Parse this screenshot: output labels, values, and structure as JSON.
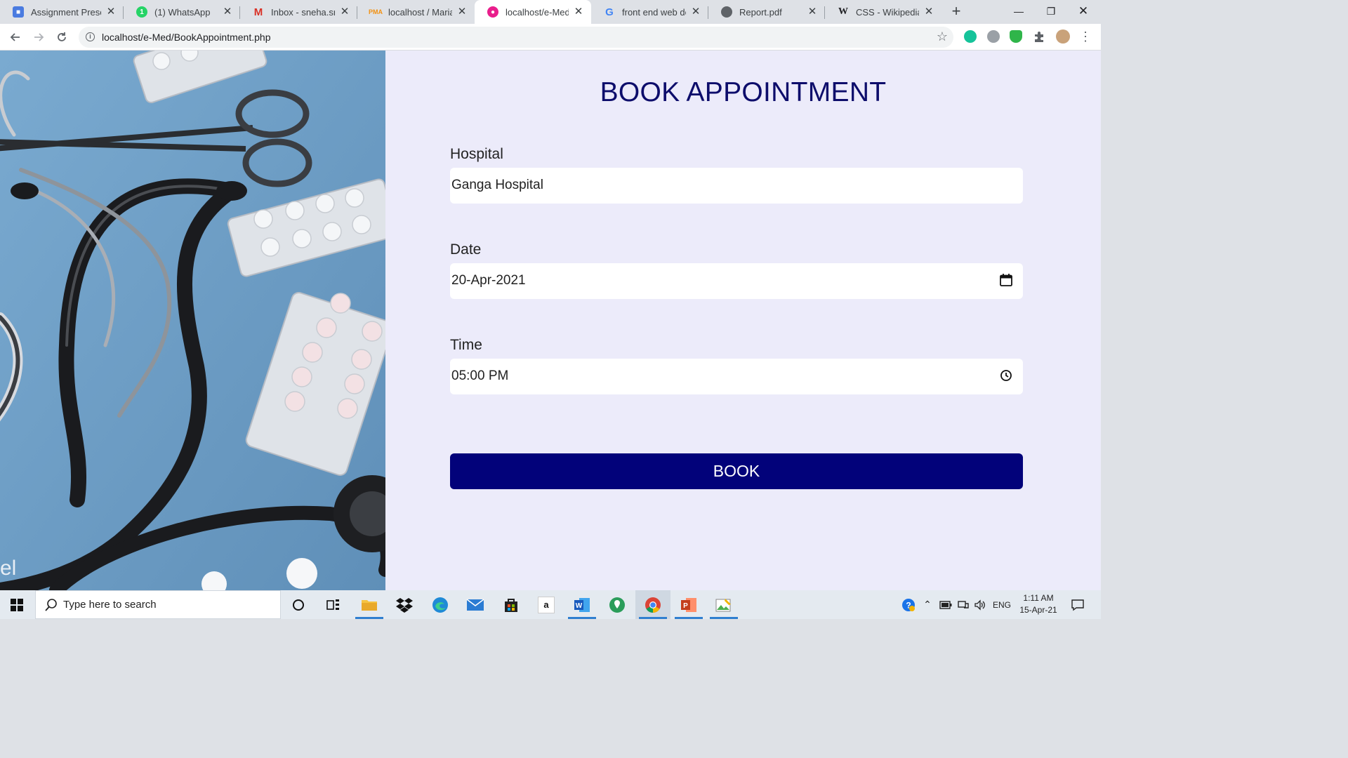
{
  "browser": {
    "tabs": [
      {
        "label": "Assignment Presen",
        "icon": "classroom-icon",
        "color": "#4a7be0",
        "active": false
      },
      {
        "label": "(1) WhatsApp",
        "icon": "whatsapp-icon",
        "color": "#25d366",
        "active": false
      },
      {
        "label": "Inbox - sneha.sridh",
        "icon": "gmail-icon",
        "color": "#d93025",
        "active": false
      },
      {
        "label": "localhost / MariaD",
        "icon": "phpmyadmin-icon",
        "color": "#f29111",
        "active": false
      },
      {
        "label": "localhost/e-Med/B",
        "icon": "site-icon",
        "color": "#e91e8c",
        "active": true
      },
      {
        "label": "front end web dev",
        "icon": "google-icon",
        "color": "#4285f4",
        "active": false
      },
      {
        "label": "Report.pdf",
        "icon": "globe-icon",
        "color": "#5f6368",
        "active": false
      },
      {
        "label": "CSS - Wikipedia",
        "icon": "wikipedia-icon",
        "color": "#202124",
        "active": false
      }
    ],
    "url": "localhost/e-Med/BookAppointment.php"
  },
  "page": {
    "title": "BOOK APPOINTMENT",
    "hero_watermark": "el",
    "fields": {
      "hospital": {
        "label": "Hospital",
        "value": "Ganga Hospital"
      },
      "date": {
        "label": "Date",
        "value": "20-Apr-2021"
      },
      "time": {
        "label": "Time",
        "value": "05:00 PM"
      }
    },
    "book_label": "BOOK",
    "colors": {
      "title": "#0d0d6b",
      "button": "#02027a",
      "background": "#ecebfa"
    }
  },
  "taskbar": {
    "search_placeholder": "Type here to search",
    "amazon_letter": "a",
    "language": "ENG",
    "time": "1:11 AM",
    "date": "15-Apr-21"
  }
}
